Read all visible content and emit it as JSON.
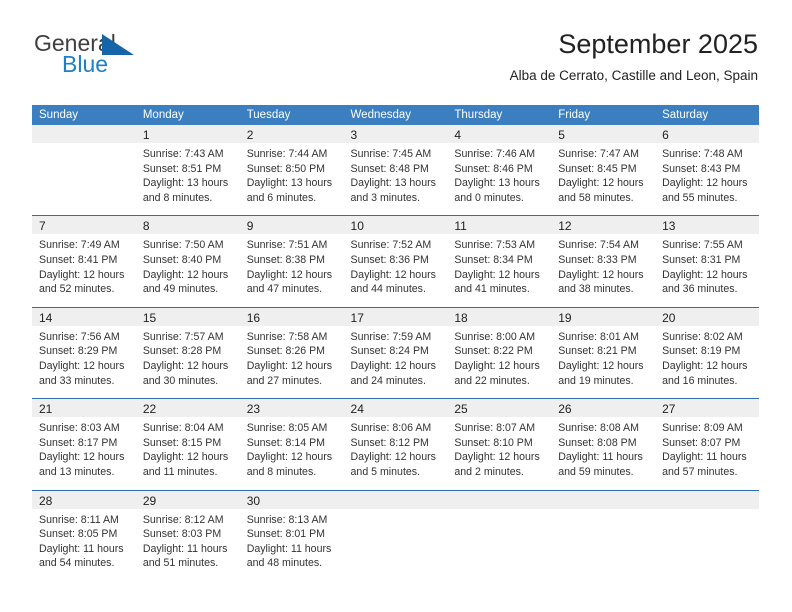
{
  "brand": {
    "name_part1": "General",
    "name_part2": "Blue",
    "triangle_color": "#1565a8",
    "blue_color": "#1f7ec4"
  },
  "header": {
    "title": "September 2025",
    "subtitle": "Alba de Cerrato, Castille and Leon, Spain"
  },
  "theme": {
    "header_blue": "#3b7fc0",
    "row_divider_blue": "#2f6fb0",
    "daynum_background": "#efefef"
  },
  "calendar": {
    "weekday_headers": [
      "Sunday",
      "Monday",
      "Tuesday",
      "Wednesday",
      "Thursday",
      "Friday",
      "Saturday"
    ],
    "weeks": [
      [
        {
          "day": "",
          "sunrise": "",
          "sunset": "",
          "daylight": ""
        },
        {
          "day": "1",
          "sunrise": "Sunrise: 7:43 AM",
          "sunset": "Sunset: 8:51 PM",
          "daylight": "Daylight: 13 hours and 8 minutes."
        },
        {
          "day": "2",
          "sunrise": "Sunrise: 7:44 AM",
          "sunset": "Sunset: 8:50 PM",
          "daylight": "Daylight: 13 hours and 6 minutes."
        },
        {
          "day": "3",
          "sunrise": "Sunrise: 7:45 AM",
          "sunset": "Sunset: 8:48 PM",
          "daylight": "Daylight: 13 hours and 3 minutes."
        },
        {
          "day": "4",
          "sunrise": "Sunrise: 7:46 AM",
          "sunset": "Sunset: 8:46 PM",
          "daylight": "Daylight: 13 hours and 0 minutes."
        },
        {
          "day": "5",
          "sunrise": "Sunrise: 7:47 AM",
          "sunset": "Sunset: 8:45 PM",
          "daylight": "Daylight: 12 hours and 58 minutes."
        },
        {
          "day": "6",
          "sunrise": "Sunrise: 7:48 AM",
          "sunset": "Sunset: 8:43 PM",
          "daylight": "Daylight: 12 hours and 55 minutes."
        }
      ],
      [
        {
          "day": "7",
          "sunrise": "Sunrise: 7:49 AM",
          "sunset": "Sunset: 8:41 PM",
          "daylight": "Daylight: 12 hours and 52 minutes."
        },
        {
          "day": "8",
          "sunrise": "Sunrise: 7:50 AM",
          "sunset": "Sunset: 8:40 PM",
          "daylight": "Daylight: 12 hours and 49 minutes."
        },
        {
          "day": "9",
          "sunrise": "Sunrise: 7:51 AM",
          "sunset": "Sunset: 8:38 PM",
          "daylight": "Daylight: 12 hours and 47 minutes."
        },
        {
          "day": "10",
          "sunrise": "Sunrise: 7:52 AM",
          "sunset": "Sunset: 8:36 PM",
          "daylight": "Daylight: 12 hours and 44 minutes."
        },
        {
          "day": "11",
          "sunrise": "Sunrise: 7:53 AM",
          "sunset": "Sunset: 8:34 PM",
          "daylight": "Daylight: 12 hours and 41 minutes."
        },
        {
          "day": "12",
          "sunrise": "Sunrise: 7:54 AM",
          "sunset": "Sunset: 8:33 PM",
          "daylight": "Daylight: 12 hours and 38 minutes."
        },
        {
          "day": "13",
          "sunrise": "Sunrise: 7:55 AM",
          "sunset": "Sunset: 8:31 PM",
          "daylight": "Daylight: 12 hours and 36 minutes."
        }
      ],
      [
        {
          "day": "14",
          "sunrise": "Sunrise: 7:56 AM",
          "sunset": "Sunset: 8:29 PM",
          "daylight": "Daylight: 12 hours and 33 minutes."
        },
        {
          "day": "15",
          "sunrise": "Sunrise: 7:57 AM",
          "sunset": "Sunset: 8:28 PM",
          "daylight": "Daylight: 12 hours and 30 minutes."
        },
        {
          "day": "16",
          "sunrise": "Sunrise: 7:58 AM",
          "sunset": "Sunset: 8:26 PM",
          "daylight": "Daylight: 12 hours and 27 minutes."
        },
        {
          "day": "17",
          "sunrise": "Sunrise: 7:59 AM",
          "sunset": "Sunset: 8:24 PM",
          "daylight": "Daylight: 12 hours and 24 minutes."
        },
        {
          "day": "18",
          "sunrise": "Sunrise: 8:00 AM",
          "sunset": "Sunset: 8:22 PM",
          "daylight": "Daylight: 12 hours and 22 minutes."
        },
        {
          "day": "19",
          "sunrise": "Sunrise: 8:01 AM",
          "sunset": "Sunset: 8:21 PM",
          "daylight": "Daylight: 12 hours and 19 minutes."
        },
        {
          "day": "20",
          "sunrise": "Sunrise: 8:02 AM",
          "sunset": "Sunset: 8:19 PM",
          "daylight": "Daylight: 12 hours and 16 minutes."
        }
      ],
      [
        {
          "day": "21",
          "sunrise": "Sunrise: 8:03 AM",
          "sunset": "Sunset: 8:17 PM",
          "daylight": "Daylight: 12 hours and 13 minutes."
        },
        {
          "day": "22",
          "sunrise": "Sunrise: 8:04 AM",
          "sunset": "Sunset: 8:15 PM",
          "daylight": "Daylight: 12 hours and 11 minutes."
        },
        {
          "day": "23",
          "sunrise": "Sunrise: 8:05 AM",
          "sunset": "Sunset: 8:14 PM",
          "daylight": "Daylight: 12 hours and 8 minutes."
        },
        {
          "day": "24",
          "sunrise": "Sunrise: 8:06 AM",
          "sunset": "Sunset: 8:12 PM",
          "daylight": "Daylight: 12 hours and 5 minutes."
        },
        {
          "day": "25",
          "sunrise": "Sunrise: 8:07 AM",
          "sunset": "Sunset: 8:10 PM",
          "daylight": "Daylight: 12 hours and 2 minutes."
        },
        {
          "day": "26",
          "sunrise": "Sunrise: 8:08 AM",
          "sunset": "Sunset: 8:08 PM",
          "daylight": "Daylight: 11 hours and 59 minutes."
        },
        {
          "day": "27",
          "sunrise": "Sunrise: 8:09 AM",
          "sunset": "Sunset: 8:07 PM",
          "daylight": "Daylight: 11 hours and 57 minutes."
        }
      ],
      [
        {
          "day": "28",
          "sunrise": "Sunrise: 8:11 AM",
          "sunset": "Sunset: 8:05 PM",
          "daylight": "Daylight: 11 hours and 54 minutes."
        },
        {
          "day": "29",
          "sunrise": "Sunrise: 8:12 AM",
          "sunset": "Sunset: 8:03 PM",
          "daylight": "Daylight: 11 hours and 51 minutes."
        },
        {
          "day": "30",
          "sunrise": "Sunrise: 8:13 AM",
          "sunset": "Sunset: 8:01 PM",
          "daylight": "Daylight: 11 hours and 48 minutes."
        },
        {
          "day": "",
          "sunrise": "",
          "sunset": "",
          "daylight": ""
        },
        {
          "day": "",
          "sunrise": "",
          "sunset": "",
          "daylight": ""
        },
        {
          "day": "",
          "sunrise": "",
          "sunset": "",
          "daylight": ""
        },
        {
          "day": "",
          "sunrise": "",
          "sunset": "",
          "daylight": ""
        }
      ]
    ]
  }
}
